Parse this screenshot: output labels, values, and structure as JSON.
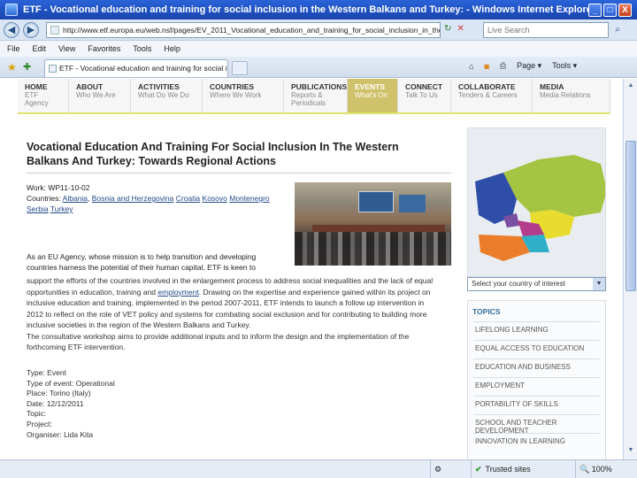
{
  "window": {
    "title": "ETF - Vocational education and training for social inclusion in the Western Balkans and Turkey: - Windows Internet Explorer pro",
    "minimize": "_",
    "maximize": "□",
    "close": "X"
  },
  "address": {
    "url": "http://www.etf.europa.eu/web.nsf/pages/EV_2011_Vocational_education_and_training_for_social_inclusion_in_the_West",
    "search_placeholder": "Live Search"
  },
  "menu": [
    "File",
    "Edit",
    "View",
    "Favorites",
    "Tools",
    "Help"
  ],
  "tab": {
    "label": "ETF - Vocational education and training for social inc..."
  },
  "commands": {
    "page": "Page",
    "tools": "Tools"
  },
  "nav": [
    {
      "title": "HOME",
      "sub": "ETF Agency"
    },
    {
      "title": "ABOUT",
      "sub": "Who We Are"
    },
    {
      "title": "ACTIVITIES",
      "sub": "What Do We Do"
    },
    {
      "title": "COUNTRIES",
      "sub": "Where We Work"
    },
    {
      "title": "PUBLICATIONS",
      "sub": "Reports & Periodicals"
    },
    {
      "title": "EVENTS",
      "sub": "What's On"
    },
    {
      "title": "CONNECT",
      "sub": "Talk To Us"
    },
    {
      "title": "COLLABORATE",
      "sub": "Tenders & Careers"
    },
    {
      "title": "MEDIA",
      "sub": "Media Relations"
    }
  ],
  "article": {
    "title": "Vocational Education And Training For Social Inclusion In The Western Balkans And Turkey: Towards Regional Actions",
    "work_label": "Work:",
    "work_value": "WP11-10-02",
    "countries_label": "Countries:",
    "countries": [
      "Albania",
      "Bosnia and Herzegovina",
      "Croatia",
      "Kosovo",
      "Montenegro",
      "Serbia",
      "Turkey"
    ],
    "intro_1": "As an EU Agency, whose mission is to help transition and developing countries harness the potential of their human capital, ETF is keen to",
    "intro_2a": "support the efforts of the countries involved in the enlargement process to address social inequalities and the lack of equal opportunities in education, training and",
    "intro_link": "employment",
    "intro_2b": ". Drawing on the expertise and experience gained within its project on inclusive education and training, implemented in the period 2007-2011, ETF intends to launch a follow up intervention in 2012 to reflect on the role of VET policy and systems for combating social exclusion and for contributing to building more inclusive societies in the region of the Western Balkans and Turkey.",
    "intro_3": "The consultative workshop aims to provide additional inputs and to inform the design and the implementation of the forthcoming ETF intervention.",
    "details": [
      {
        "label": "Type:",
        "value": "Event"
      },
      {
        "label": "Type of event:",
        "value": "Operational"
      },
      {
        "label": "Place:",
        "value": "Torino (Italy)"
      },
      {
        "label": "Date:",
        "value": "12/12/2011"
      },
      {
        "label": "Topic:",
        "value": ""
      },
      {
        "label": "Project:",
        "value": ""
      },
      {
        "label": "Organiser:",
        "value": "Lida Kita"
      }
    ]
  },
  "sidebar": {
    "country_select": "Select your country of interest",
    "topics_heading": "TOPICS",
    "topics": [
      "LIFELONG LEARNING",
      "EQUAL ACCESS TO EDUCATION",
      "EDUCATION AND BUSINESS",
      "EMPLOYMENT",
      "PORTABILITY OF SKILLS",
      "SCHOOL AND TEACHER DEVELOPMENT",
      "INNOVATION IN LEARNING"
    ]
  },
  "status": {
    "zone": "Trusted sites",
    "zoom": "100%"
  },
  "colors": {
    "nav_active": "#cfc26a",
    "nav_underline": "#dfe46a",
    "topics_heading": "#336f9e",
    "link": "#224a8a"
  }
}
